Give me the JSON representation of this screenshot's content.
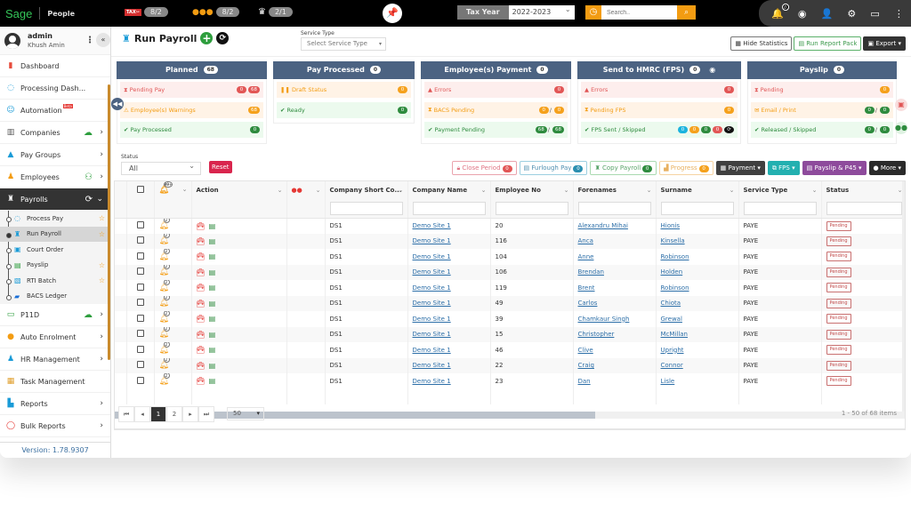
{
  "header": {
    "logo": "Sage",
    "app_name": "People",
    "indicators": [
      {
        "icon": "tax-scissors-icon",
        "value": "8/2"
      },
      {
        "icon": "coins-icon",
        "value": "8/2"
      },
      {
        "icon": "crown-icon",
        "value": "2/1"
      }
    ],
    "tax_year_label": "Tax Year",
    "tax_year_value": "2022-2023",
    "search_placeholder": "Search..",
    "notification_count": "0"
  },
  "sidebar": {
    "user_role": "admin",
    "user_name": "Khush Amin",
    "items": [
      {
        "label": "Dashboard"
      },
      {
        "label": "Processing Dash..."
      },
      {
        "label": "Automation",
        "badge": "Beta"
      },
      {
        "label": "Companies"
      },
      {
        "label": "Pay Groups"
      },
      {
        "label": "Employees"
      },
      {
        "label": "Payrolls"
      }
    ],
    "sub_items": [
      {
        "label": "Process Pay"
      },
      {
        "label": "Run Payroll"
      },
      {
        "label": "Court Order"
      },
      {
        "label": "Payslip"
      },
      {
        "label": "RTI Batch"
      },
      {
        "label": "BACS Ledger"
      }
    ],
    "items_after": [
      {
        "label": "P11D"
      },
      {
        "label": "Auto Enrolment"
      },
      {
        "label": "HR Management"
      },
      {
        "label": "Task Management"
      },
      {
        "label": "Reports"
      },
      {
        "label": "Bulk Reports"
      }
    ],
    "version": "Version: 1.78.9307"
  },
  "main": {
    "title": "Run Payroll",
    "service_type_label": "Service Type",
    "service_type_placeholder": "Select Service Type",
    "buttons": {
      "hide_statistics": "Hide Statistics",
      "run_report_pack": "Run Report Pack",
      "export": "Export"
    },
    "cards": [
      {
        "title": "Planned",
        "count": "68",
        "rows": [
          {
            "label": "Pending Pay",
            "badges": [
              "0",
              "68"
            ]
          },
          {
            "label": "Employee(s) Warnings",
            "badges": [
              "68"
            ]
          },
          {
            "label": "Pay Processed",
            "badges": [
              "0"
            ]
          }
        ]
      },
      {
        "title": "Pay Processed",
        "count": "0",
        "rows": [
          {
            "label": "Draft Status",
            "badges": [
              "0"
            ]
          },
          {
            "label": "Ready",
            "badges": [
              "0"
            ]
          }
        ]
      },
      {
        "title": "Employee(s) Payment",
        "count": "0",
        "rows": [
          {
            "label": "Errors",
            "badges": [
              "0"
            ]
          },
          {
            "label": "BACS Pending",
            "badges": [
              "0",
              "0"
            ]
          },
          {
            "label": "Payment Pending",
            "badges": [
              "68",
              "68"
            ]
          }
        ]
      },
      {
        "title": "Send to HMRC (FPS)",
        "count": "0",
        "rows": [
          {
            "label": "Errors",
            "badges": [
              "0"
            ]
          },
          {
            "label": "Pending FPS",
            "badges": [
              "0"
            ]
          },
          {
            "label": "FPS Sent / Skipped",
            "badges": [
              "0",
              "0",
              "0",
              "0"
            ]
          }
        ]
      },
      {
        "title": "Payslip",
        "count": "0",
        "rows": [
          {
            "label": "Pending",
            "badges": [
              "0"
            ]
          },
          {
            "label": "Email / Print",
            "badges": [
              "0",
              "0"
            ]
          },
          {
            "label": "Released / Skipped",
            "badges": [
              "0",
              "0"
            ]
          }
        ]
      }
    ],
    "status_label": "Status",
    "status_value": "All",
    "reset": "Reset",
    "actions": [
      {
        "label": "Close Period",
        "count": "0"
      },
      {
        "label": "Furlough Pay",
        "count": "0"
      },
      {
        "label": "Copy Payroll",
        "count": "0"
      },
      {
        "label": "Progress",
        "count": "0"
      },
      {
        "label": "Payment"
      },
      {
        "label": "FPS"
      },
      {
        "label": "Payslip & P45"
      },
      {
        "label": "More"
      }
    ],
    "columns": [
      "",
      "",
      "Action",
      "",
      "Company Short Co...",
      "Company Name",
      "Employee No",
      "Forenames",
      "Surname",
      "Service Type",
      "Status"
    ],
    "notification_header_badge": "99+",
    "rows": [
      {
        "bell": "2",
        "short": "DS1",
        "company": "Demo Site 1",
        "emp_no": "20",
        "forename": "Alexandru Mihai",
        "surname": "Hionis",
        "service": "PAYE",
        "status": "Pending"
      },
      {
        "bell": "2",
        "short": "DS1",
        "company": "Demo Site 1",
        "emp_no": "116",
        "forename": "Anca",
        "surname": "Kinsella",
        "service": "PAYE",
        "status": "Pending"
      },
      {
        "bell": "2",
        "short": "DS1",
        "company": "Demo Site 1",
        "emp_no": "104",
        "forename": "Anne",
        "surname": "Robinson",
        "service": "PAYE",
        "status": "Pending"
      },
      {
        "bell": "2",
        "short": "DS1",
        "company": "Demo Site 1",
        "emp_no": "106",
        "forename": "Brendan",
        "surname": "Holden",
        "service": "PAYE",
        "status": "Pending"
      },
      {
        "bell": "2",
        "short": "DS1",
        "company": "Demo Site 1",
        "emp_no": "119",
        "forename": "Brent",
        "surname": "Robinson",
        "service": "PAYE",
        "status": "Pending"
      },
      {
        "bell": "2",
        "short": "DS1",
        "company": "Demo Site 1",
        "emp_no": "49",
        "forename": "Carlos",
        "surname": "Chiota",
        "service": "PAYE",
        "status": "Pending"
      },
      {
        "bell": "2",
        "short": "DS1",
        "company": "Demo Site 1",
        "emp_no": "39",
        "forename": "Chamkaur Singh",
        "surname": "Grewal",
        "service": "PAYE",
        "status": "Pending"
      },
      {
        "bell": "2",
        "short": "DS1",
        "company": "Demo Site 1",
        "emp_no": "15",
        "forename": "Christopher",
        "surname": "McMillan",
        "service": "PAYE",
        "status": "Pending"
      },
      {
        "bell": "2",
        "short": "DS1",
        "company": "Demo Site 1",
        "emp_no": "46",
        "forename": "Clive",
        "surname": "Upright",
        "service": "PAYE",
        "status": "Pending"
      },
      {
        "bell": "2",
        "short": "DS1",
        "company": "Demo Site 1",
        "emp_no": "22",
        "forename": "Craig",
        "surname": "Connor",
        "service": "PAYE",
        "status": "Pending"
      },
      {
        "bell": "2",
        "short": "DS1",
        "company": "Demo Site 1",
        "emp_no": "23",
        "forename": "Dan",
        "surname": "Lisle",
        "service": "PAYE",
        "status": "Pending"
      }
    ],
    "pager": {
      "pages": [
        "1",
        "2"
      ],
      "current": "1",
      "page_size": "50",
      "info": "1 - 50 of 68 items"
    }
  }
}
